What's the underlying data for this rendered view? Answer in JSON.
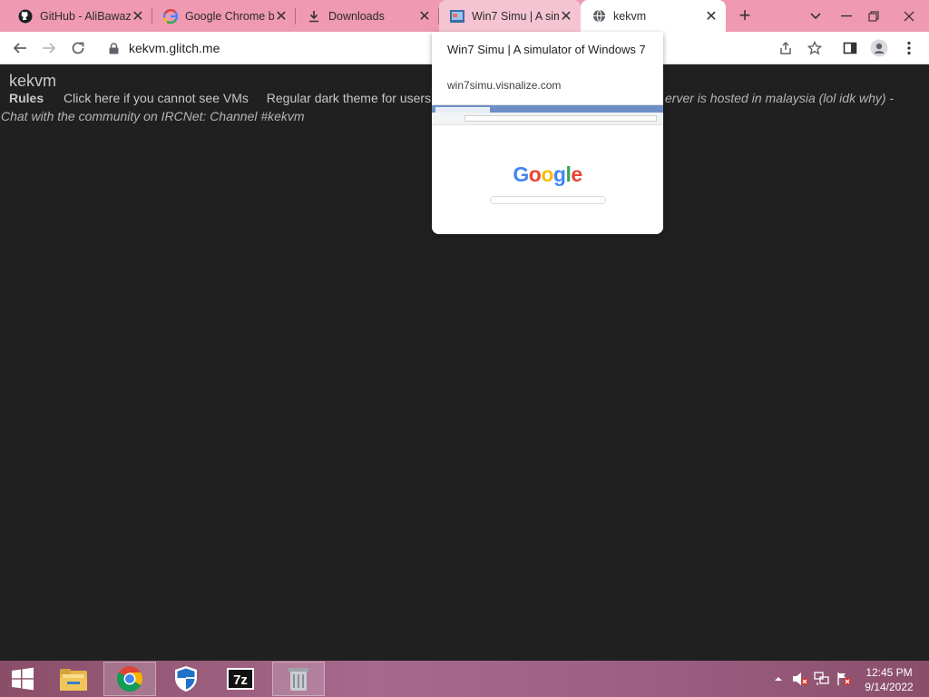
{
  "tabs": [
    {
      "title": "GitHub - AliBawazeer",
      "icon": "github-icon"
    },
    {
      "title": "Google Chrome blog",
      "icon": "google-icon"
    },
    {
      "title": "Downloads",
      "icon": "download-icon"
    },
    {
      "title": "Win7 Simu | A simulator of Windows 7",
      "icon": "win7-favicon"
    },
    {
      "title": "kekvm",
      "icon": "globe-icon"
    }
  ],
  "address_bar": {
    "url": "kekvm.glitch.me"
  },
  "page": {
    "site_title": "kekvm",
    "nav": {
      "rules": "Rules",
      "cannot_see": "Click here if you cannot see VMs",
      "dark_theme": "Regular dark theme for users w"
    },
    "italic_line1": "erver is hosted in malaysia (lol idk why) -",
    "italic_line2": "Chat with the community on IRCNet: Channel #kekvm"
  },
  "hover_card": {
    "title": "Win7 Simu | A simulator of Windows 7",
    "domain": "win7simu.visnalize.com",
    "thumbnail_logo": "Google"
  },
  "taskbar": {
    "apps": [
      "start-icon",
      "file-explorer-icon",
      "chrome-icon",
      "defender-icon",
      "7zip-icon",
      "recycle-icon"
    ],
    "clock": {
      "time": "12:45 PM",
      "date": "9/14/2022"
    }
  },
  "colors": {
    "tabstrip": "#ef99b3",
    "page_background": "#202020",
    "taskbar": "#a7698d"
  }
}
